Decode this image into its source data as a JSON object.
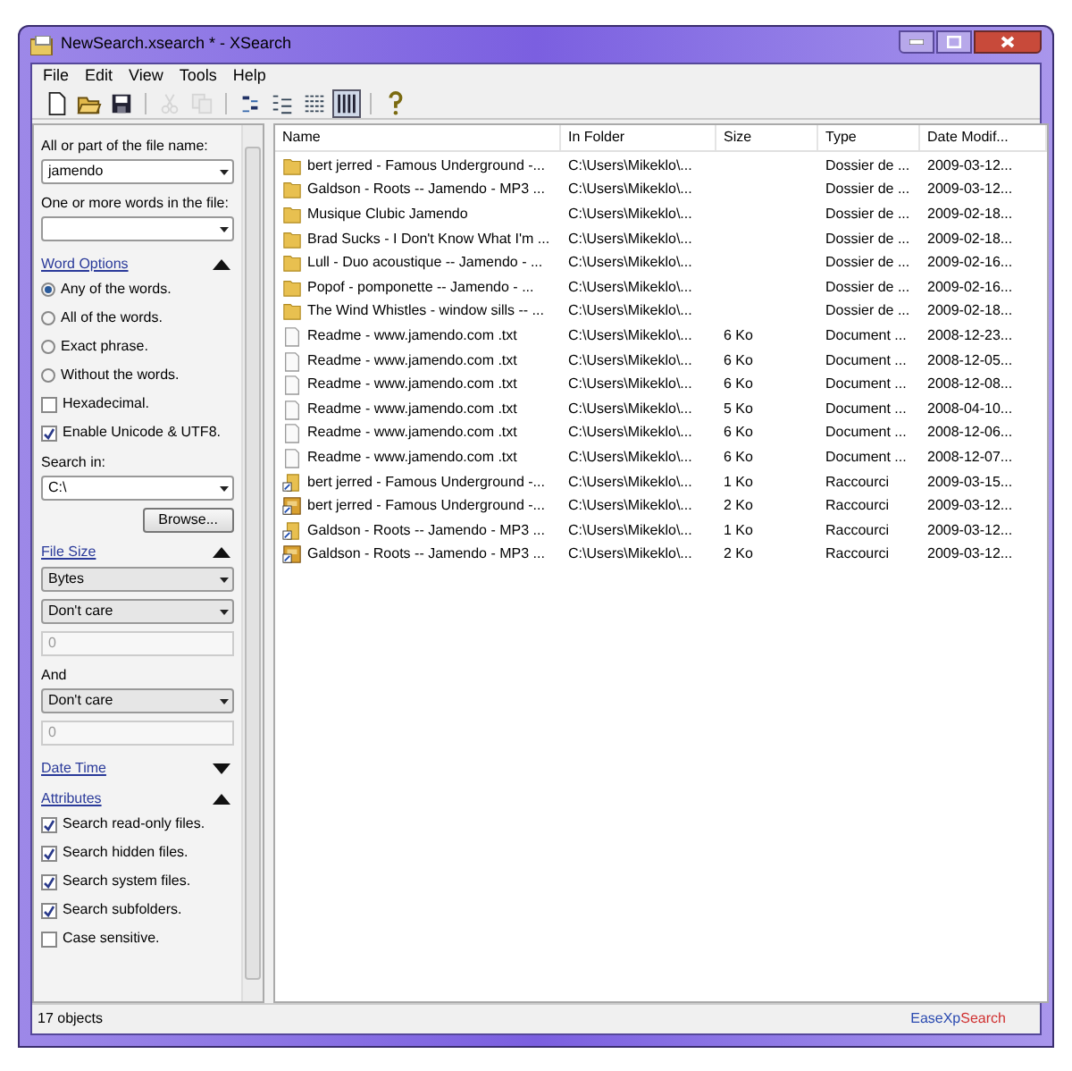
{
  "window": {
    "title": "NewSearch.xsearch * - XSearch"
  },
  "menu": [
    "File",
    "Edit",
    "View",
    "Tools",
    "Help"
  ],
  "toolbar": [
    [
      {
        "kind": "new",
        "disabled": false
      },
      {
        "kind": "open",
        "disabled": false
      },
      {
        "kind": "save",
        "disabled": false
      }
    ],
    [
      {
        "kind": "cut",
        "disabled": true
      },
      {
        "kind": "copy",
        "disabled": true
      }
    ],
    [
      {
        "kind": "view-icons",
        "selected": false
      },
      {
        "kind": "view-list",
        "selected": false
      },
      {
        "kind": "view-details",
        "selected": false
      },
      {
        "kind": "view-columns",
        "selected": true
      }
    ],
    [
      {
        "kind": "help",
        "disabled": false
      }
    ]
  ],
  "panel": [
    {
      "kind": "label",
      "text": "All or part of the file name:"
    },
    {
      "kind": "combo",
      "value": "jamendo"
    },
    {
      "kind": "label",
      "text": "One or more words in the file:"
    },
    {
      "kind": "combo"
    },
    {
      "kind": "section",
      "text": "Word Options",
      "expanded": true
    },
    {
      "kind": "radio",
      "text": "Any of the words.",
      "selected": true
    },
    {
      "kind": "radio",
      "text": "All of the words.",
      "selected": false
    },
    {
      "kind": "radio",
      "text": "Exact phrase.",
      "selected": false
    },
    {
      "kind": "radio",
      "text": "Without the words.",
      "selected": false
    },
    {
      "kind": "checkbox",
      "text": "Hexadecimal.",
      "checked": false
    },
    {
      "kind": "checkbox",
      "text": "Enable Unicode & UTF8.",
      "checked": true
    },
    {
      "kind": "label",
      "text": "Search in:"
    },
    {
      "kind": "combo",
      "value": "C:\\"
    },
    {
      "kind": "button",
      "text": "Browse..."
    },
    {
      "kind": "section",
      "text": "File Size",
      "expanded": true
    },
    {
      "kind": "combo",
      "value": "Bytes"
    },
    {
      "kind": "combo",
      "value": "Don't care"
    },
    {
      "kind": "input",
      "value": "0",
      "disabled": true
    },
    {
      "kind": "label",
      "text": "And"
    },
    {
      "kind": "combo",
      "value": "Don't care"
    },
    {
      "kind": "input",
      "value": "0",
      "disabled": true
    },
    {
      "kind": "section",
      "text": "Date Time",
      "expanded": false
    },
    {
      "kind": "section",
      "text": "Attributes",
      "expanded": true
    },
    {
      "kind": "checkbox",
      "text": "Search read-only files.",
      "checked": true
    },
    {
      "kind": "checkbox",
      "text": "Search hidden files.",
      "checked": true
    },
    {
      "kind": "checkbox",
      "text": "Search system files.",
      "checked": true
    },
    {
      "kind": "checkbox",
      "text": "Search subfolders.",
      "checked": true
    },
    {
      "kind": "checkbox",
      "text": "Case sensitive.",
      "checked": false
    }
  ],
  "table": {
    "columns": [
      "Name",
      "In Folder",
      "Size",
      "Type",
      "Date Modif..."
    ],
    "rows": [
      {
        "kind": "folder",
        "cells": [
          "bert jerred - Famous Underground -...",
          "C:\\Users\\Mikeklo\\...",
          "",
          "Dossier de ...",
          "2009-03-12..."
        ]
      },
      {
        "kind": "folder",
        "cells": [
          "Galdson - Roots -- Jamendo - MP3 ...",
          "C:\\Users\\Mikeklo\\...",
          "",
          "Dossier de ...",
          "2009-03-12..."
        ]
      },
      {
        "kind": "folder",
        "cells": [
          "Musique Clubic Jamendo",
          "C:\\Users\\Mikeklo\\...",
          "",
          "Dossier de ...",
          "2009-02-18..."
        ]
      },
      {
        "kind": "folder",
        "cells": [
          "Brad Sucks - I Don't Know What I'm ...",
          "C:\\Users\\Mikeklo\\...",
          "",
          "Dossier de ...",
          "2009-02-18..."
        ]
      },
      {
        "kind": "folder",
        "cells": [
          "Lull - Duo acoustique -- Jamendo - ...",
          "C:\\Users\\Mikeklo\\...",
          "",
          "Dossier de ...",
          "2009-02-16..."
        ]
      },
      {
        "kind": "folder",
        "cells": [
          "Popof - pomponette -- Jamendo - ...",
          "C:\\Users\\Mikeklo\\...",
          "",
          "Dossier de ...",
          "2009-02-16..."
        ]
      },
      {
        "kind": "folder",
        "cells": [
          "The Wind Whistles - window sills -- ...",
          "C:\\Users\\Mikeklo\\...",
          "",
          "Dossier de ...",
          "2009-02-18..."
        ]
      },
      {
        "kind": "document",
        "cells": [
          "Readme - www.jamendo.com .txt",
          "C:\\Users\\Mikeklo\\...",
          "6 Ko",
          "Document ...",
          "2008-12-23..."
        ]
      },
      {
        "kind": "document",
        "cells": [
          "Readme - www.jamendo.com .txt",
          "C:\\Users\\Mikeklo\\...",
          "6 Ko",
          "Document ...",
          "2008-12-05..."
        ]
      },
      {
        "kind": "document",
        "cells": [
          "Readme - www.jamendo.com .txt",
          "C:\\Users\\Mikeklo\\...",
          "6 Ko",
          "Document ...",
          "2008-12-08..."
        ]
      },
      {
        "kind": "document",
        "cells": [
          "Readme - www.jamendo.com .txt",
          "C:\\Users\\Mikeklo\\...",
          "5 Ko",
          "Document ...",
          "2008-04-10..."
        ]
      },
      {
        "kind": "document",
        "cells": [
          "Readme - www.jamendo.com .txt",
          "C:\\Users\\Mikeklo\\...",
          "6 Ko",
          "Document ...",
          "2008-12-06..."
        ]
      },
      {
        "kind": "document",
        "cells": [
          "Readme - www.jamendo.com .txt",
          "C:\\Users\\Mikeklo\\...",
          "6 Ko",
          "Document ...",
          "2008-12-07..."
        ]
      },
      {
        "kind": "shortcut",
        "cells": [
          "bert jerred - Famous Underground -...",
          "C:\\Users\\Mikeklo\\...",
          "1 Ko",
          "Raccourci",
          "2009-03-15..."
        ]
      },
      {
        "kind": "archive-shortcut",
        "cells": [
          "bert jerred - Famous Underground -...",
          "C:\\Users\\Mikeklo\\...",
          "2 Ko",
          "Raccourci",
          "2009-03-12..."
        ]
      },
      {
        "kind": "shortcut",
        "cells": [
          "Galdson - Roots -- Jamendo - MP3 ...",
          "C:\\Users\\Mikeklo\\...",
          "1 Ko",
          "Raccourci",
          "2009-03-12..."
        ]
      },
      {
        "kind": "archive-shortcut",
        "cells": [
          "Galdson - Roots -- Jamendo - MP3 ...",
          "C:\\Users\\Mikeklo\\...",
          "2 Ko",
          "Raccourci",
          "2009-03-12..."
        ]
      }
    ]
  },
  "status_bar": {
    "text": "17 objects",
    "brand": [
      "EaseXp",
      "Search"
    ]
  }
}
